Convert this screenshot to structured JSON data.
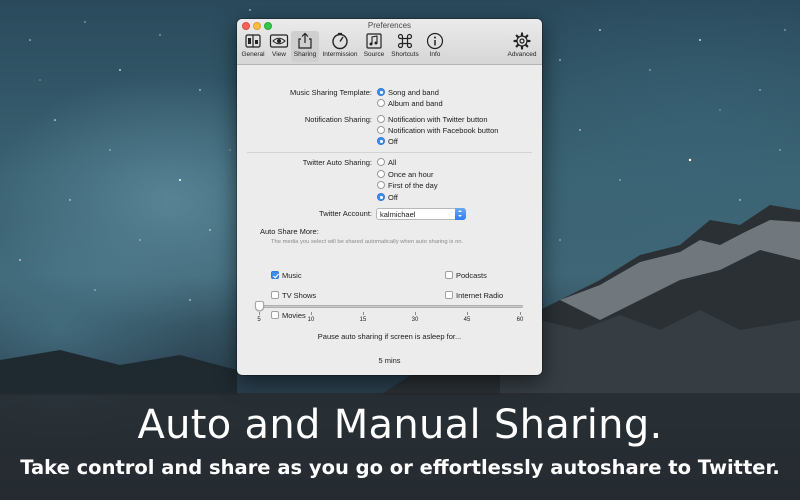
{
  "window": {
    "title": "Preferences"
  },
  "toolbar": [
    {
      "label": "General",
      "icon": "general-icon"
    },
    {
      "label": "View",
      "icon": "eye-icon"
    },
    {
      "label": "Sharing",
      "icon": "share-icon",
      "selected": true
    },
    {
      "label": "Intermission",
      "icon": "timer-icon"
    },
    {
      "label": "Source",
      "icon": "music-note-icon"
    },
    {
      "label": "Shortcuts",
      "icon": "command-key-icon"
    },
    {
      "label": "Info",
      "icon": "info-icon"
    },
    {
      "label": "Advanced",
      "icon": "gear-icon"
    }
  ],
  "music_template": {
    "label": "Music Sharing Template:",
    "options": [
      "Song and band",
      "Album and band"
    ],
    "selected": 0
  },
  "notification_sharing": {
    "label": "Notification Sharing:",
    "options": [
      "Notification with Twitter button",
      "Notification with Facebook button",
      "Off"
    ],
    "selected": 2
  },
  "twitter_auto": {
    "label": "Twitter Auto Sharing:",
    "options": [
      "All",
      "Once an hour",
      "First of the day",
      "Off"
    ],
    "selected": 3
  },
  "twitter_account": {
    "label": "Twitter Account:",
    "value": "kalmichael"
  },
  "auto_share_more": {
    "title": "Auto Share More:",
    "hint": "The media you select will be shared automatically when auto sharing is on.",
    "items": [
      {
        "label": "Music",
        "checked": true
      },
      {
        "label": "Podcasts",
        "checked": false
      },
      {
        "label": "TV Shows",
        "checked": false
      },
      {
        "label": "Internet Radio",
        "checked": false
      },
      {
        "label": "Movies",
        "checked": false
      }
    ]
  },
  "pause_sleep": {
    "label": "Pause auto sharing if screen is asleep for...",
    "ticks": [
      "5",
      "10",
      "15",
      "30",
      "45",
      "60"
    ],
    "value_label": "5 mins",
    "value_index": 0
  },
  "banner": {
    "headline": "Auto and Manual Sharing.",
    "subline": "Take control and share as you go or effortlessly autoshare to Twitter."
  },
  "colors": {
    "accent": "#3d8ff3",
    "band": "#2c3034"
  }
}
